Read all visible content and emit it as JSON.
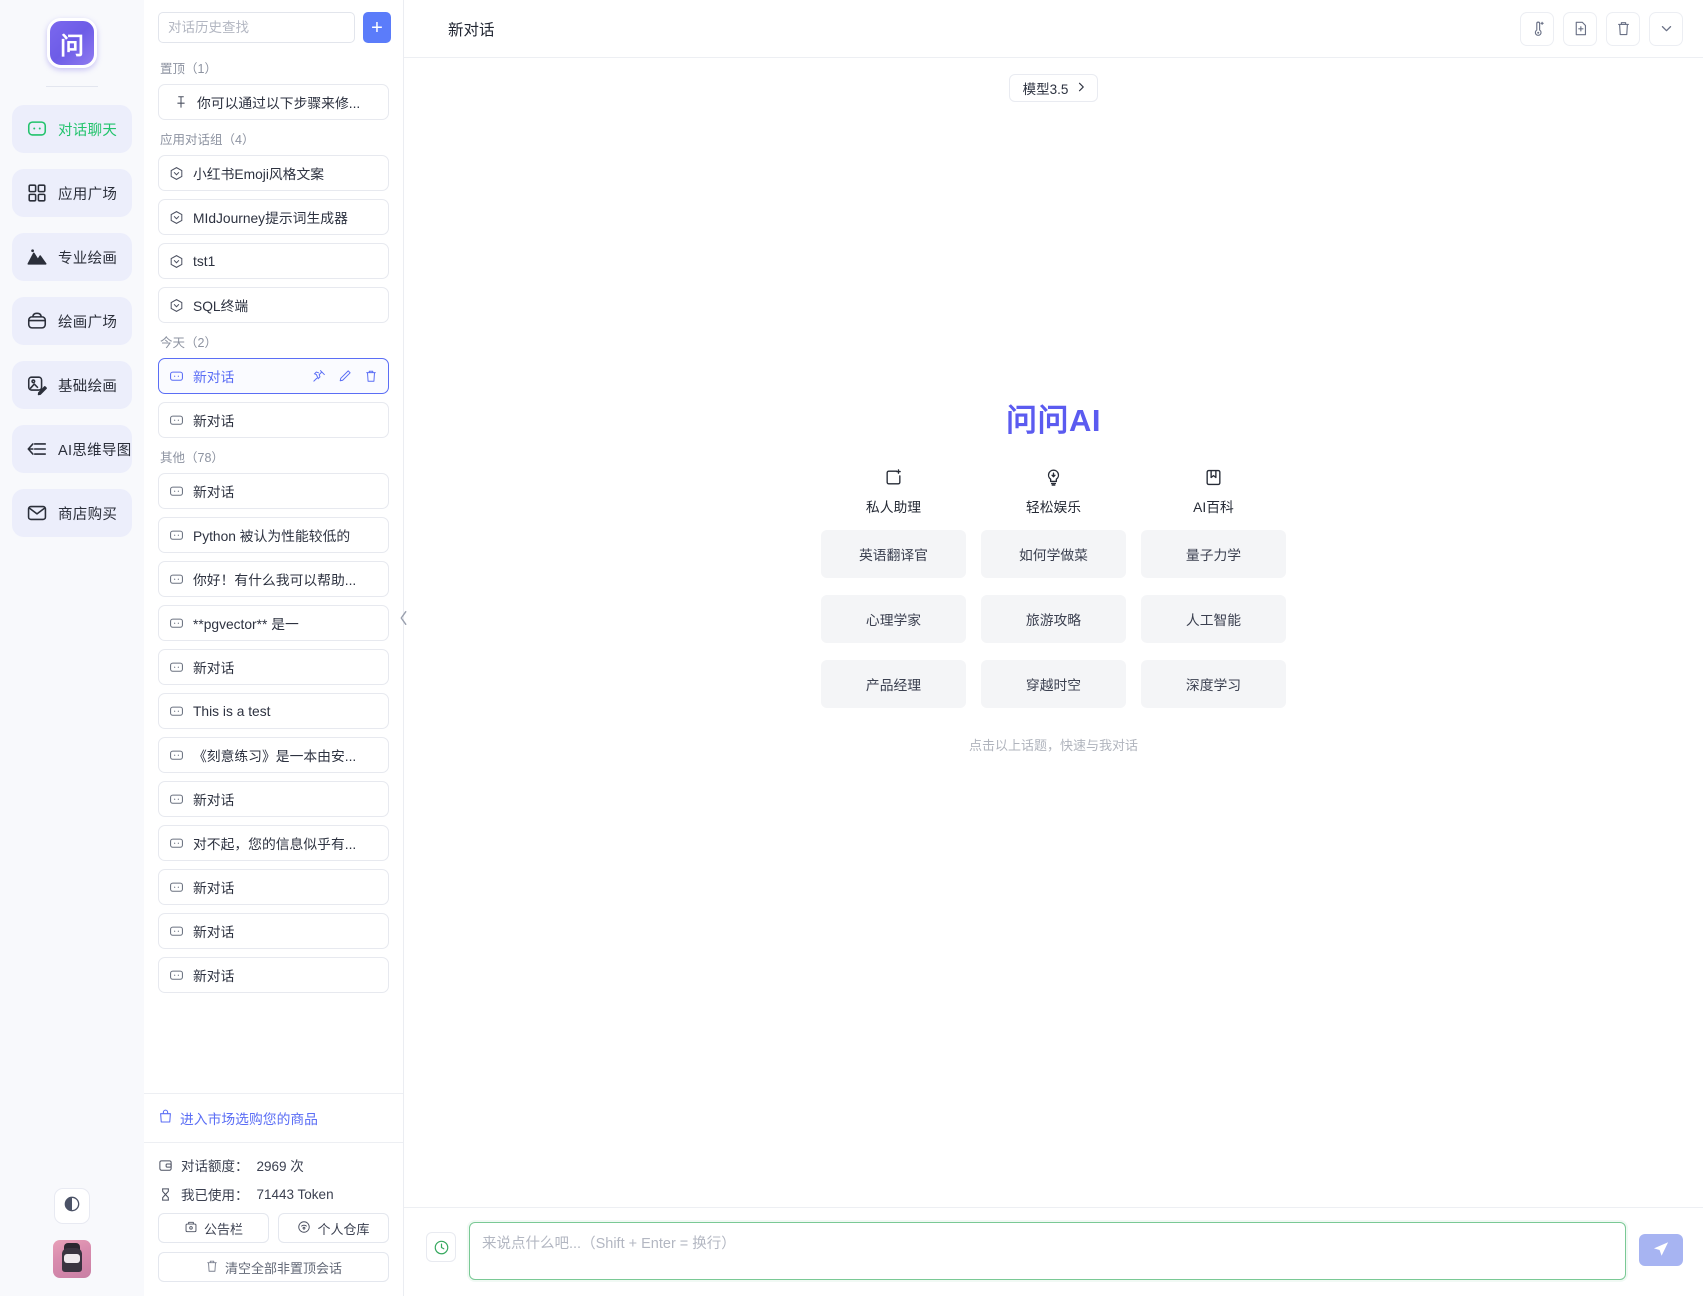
{
  "rail": {
    "logo_text": "问",
    "items": [
      {
        "label": "对话聊天",
        "icon": "chat-icon",
        "active": true
      },
      {
        "label": "应用广场",
        "icon": "grid-icon",
        "active": false
      },
      {
        "label": "专业绘画",
        "icon": "mountain-icon",
        "active": false
      },
      {
        "label": "绘画广场",
        "icon": "palette-icon",
        "active": false
      },
      {
        "label": "基础绘画",
        "icon": "image-pen-icon",
        "active": false
      },
      {
        "label": "AI思维导图",
        "icon": "mindmap-icon",
        "active": false
      },
      {
        "label": "商店购买",
        "icon": "shop-icon",
        "active": false
      }
    ],
    "theme_toggle": "theme-toggle-icon",
    "avatar": "user-avatar"
  },
  "sidebar": {
    "search_placeholder": "对话历史查找",
    "add_label": "+",
    "groups": [
      {
        "label": "置顶（1）",
        "items": [
          {
            "title": "你可以通过以下步骤来修...",
            "icon": "pin-icon",
            "selected": false
          }
        ]
      },
      {
        "label": "应用对话组（4）",
        "items": [
          {
            "title": "小红书Emoji风格文案",
            "icon": "app-icon",
            "selected": false
          },
          {
            "title": "MIdJourney提示词生成器",
            "icon": "app-icon",
            "selected": false
          },
          {
            "title": "tst1",
            "icon": "app-icon",
            "selected": false
          },
          {
            "title": "SQL终端",
            "icon": "app-icon",
            "selected": false
          }
        ]
      },
      {
        "label": "今天（2）",
        "items": [
          {
            "title": "新对话",
            "icon": "chat-bubble-icon",
            "selected": true
          },
          {
            "title": "新对话",
            "icon": "chat-bubble-icon",
            "selected": false
          }
        ]
      },
      {
        "label": "其他（78）",
        "items": [
          {
            "title": "新对话",
            "icon": "chat-bubble-icon",
            "selected": false
          },
          {
            "title": "Python 被认为性能较低的",
            "icon": "chat-bubble-icon",
            "selected": false
          },
          {
            "title": "你好！有什么我可以帮助...",
            "icon": "chat-bubble-icon",
            "selected": false
          },
          {
            "title": "**pgvector** 是一",
            "icon": "chat-bubble-icon",
            "selected": false
          },
          {
            "title": "新对话",
            "icon": "chat-bubble-icon",
            "selected": false
          },
          {
            "title": "This is a test",
            "icon": "chat-bubble-icon",
            "selected": false
          },
          {
            "title": "《刻意练习》是一本由安...",
            "icon": "chat-bubble-icon",
            "selected": false
          },
          {
            "title": "新对话",
            "icon": "chat-bubble-icon",
            "selected": false
          },
          {
            "title": "对不起，您的信息似乎有...",
            "icon": "chat-bubble-icon",
            "selected": false
          },
          {
            "title": "新对话",
            "icon": "chat-bubble-icon",
            "selected": false
          },
          {
            "title": "新对话",
            "icon": "chat-bubble-icon",
            "selected": false
          },
          {
            "title": "新对话",
            "icon": "chat-bubble-icon",
            "selected": false
          }
        ]
      }
    ],
    "selected_actions": [
      "pin-icon",
      "edit-icon",
      "delete-icon"
    ],
    "market_link": "进入市场选购您的商品",
    "quota_label": "对话额度：",
    "quota_value": "2969 次",
    "token_label": "我已使用：",
    "token_value": "71443 Token",
    "btn_notice": "公告栏",
    "btn_warehouse": "个人仓库",
    "btn_clear": "清空全部非置顶会话"
  },
  "topbar": {
    "title": "新对话",
    "icons": [
      "thermometer-icon",
      "file-add-icon",
      "trash-icon",
      "chevron-down-icon"
    ]
  },
  "main": {
    "model_chip": "模型3.5",
    "brand": "问问AI",
    "categories": [
      {
        "label": "私人助理",
        "icon": "add-frame-icon",
        "topics": [
          "英语翻译官",
          "心理学家",
          "产品经理"
        ]
      },
      {
        "label": "轻松娱乐",
        "icon": "bulb-icon",
        "topics": [
          "如何学做菜",
          "旅游攻略",
          "穿越时空"
        ]
      },
      {
        "label": "AI百科",
        "icon": "book-icon",
        "topics": [
          "量子力学",
          "人工智能",
          "深度学习"
        ]
      }
    ],
    "hint": "点击以上话题，快速与我对话"
  },
  "composer": {
    "history_icon": "history-icon",
    "placeholder": "来说点什么吧...（Shift + Enter = 换行）",
    "value": "",
    "send_icon": "send-icon"
  },
  "colors": {
    "accent_blue": "#5b6ef5",
    "brand_purple": "#5b5bf0",
    "green_active": "#22c36c",
    "composer_border": "#7ac995",
    "send_bg": "#a7b4f2",
    "rail_bg": "#f8f9fc"
  }
}
